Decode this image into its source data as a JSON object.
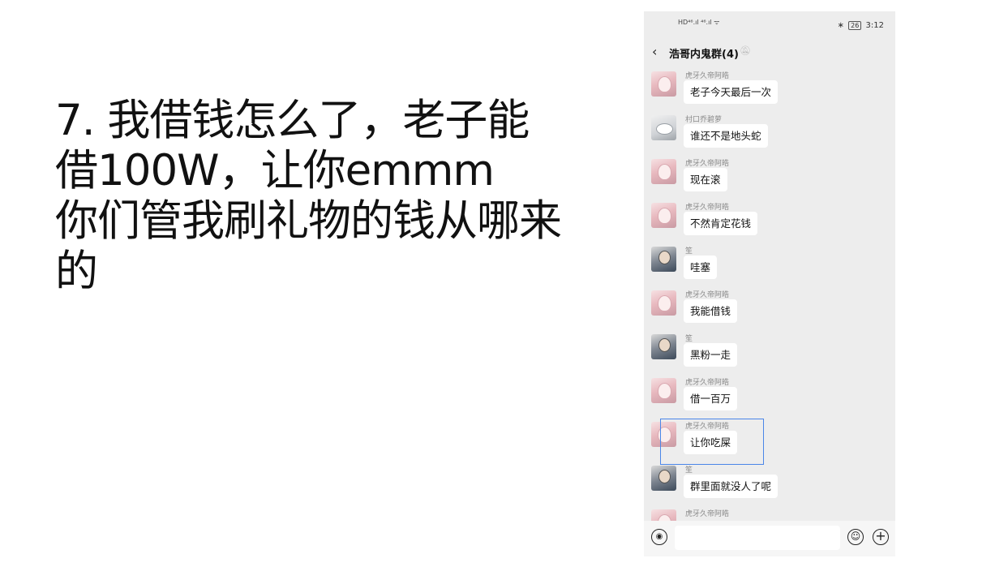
{
  "slide": {
    "lines": [
      "7. 我借钱怎么了，老子能",
      "借100W，让你emmm",
      "你们管我刷礼物的钱从哪来",
      "的"
    ]
  },
  "status_bar": {
    "left_indicators": "HD⁴⁶.ıl ⁴⁶.ıl ᯤ",
    "bluetooth": "∗",
    "battery": "26",
    "time": "3:12"
  },
  "chat": {
    "title": "浩哥内鬼群(4)",
    "messages": [
      {
        "sender": "虎牙久帝阿皓",
        "text": "老子今天最后一次",
        "avatar": "girl"
      },
      {
        "sender": "村口乔碧萝",
        "text": "谁还不是地头蛇",
        "avatar": "anime"
      },
      {
        "sender": "虎牙久帝阿皓",
        "text": "现在滚",
        "avatar": "girl"
      },
      {
        "sender": "虎牙久帝阿皓",
        "text": "不然肯定花钱",
        "avatar": "girl"
      },
      {
        "sender": "笙",
        "text": "哇塞",
        "avatar": "boy"
      },
      {
        "sender": "虎牙久帝阿皓",
        "text": "我能借钱",
        "avatar": "girl"
      },
      {
        "sender": "笙",
        "text": "黑粉一走",
        "avatar": "boy"
      },
      {
        "sender": "虎牙久帝阿皓",
        "text": "借一百万",
        "avatar": "girl"
      },
      {
        "sender": "虎牙久帝阿皓",
        "text": "让你吃屎",
        "avatar": "girl"
      },
      {
        "sender": "笙",
        "text": "群里面就没人了呢",
        "avatar": "boy"
      },
      {
        "sender": "虎牙久帝阿皓",
        "text": "",
        "avatar": "girl"
      }
    ]
  },
  "input_bar": {
    "voice_icon": "◉",
    "emoji_icon": "☺",
    "plus_icon": "+",
    "placeholder": ""
  },
  "colors": {
    "chat_background": "#ededed",
    "bubble": "#ffffff",
    "highlight": "#4a86e8"
  }
}
